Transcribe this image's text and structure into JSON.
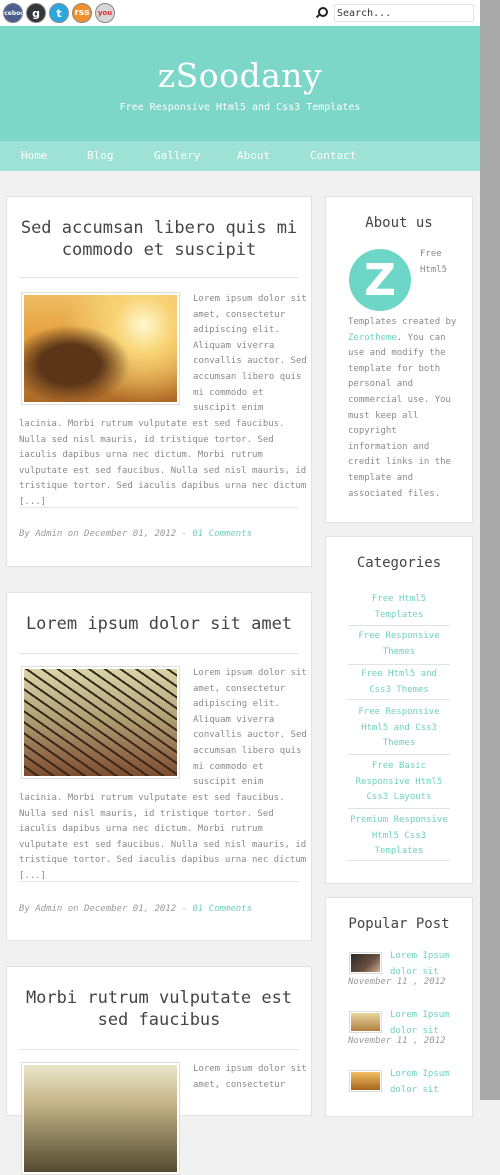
{
  "topbar": {
    "social": [
      "facebook",
      "g",
      "t",
      "rss",
      "you"
    ],
    "search_placeholder": "Search..."
  },
  "header": {
    "site_title": "zSoodany",
    "tagline": "Free Responsive Html5 and Css3 Templates"
  },
  "nav": {
    "items": [
      {
        "label": "Home"
      },
      {
        "label": "Blog"
      },
      {
        "label": "Gallery"
      },
      {
        "label": "About"
      },
      {
        "label": "Contact"
      }
    ]
  },
  "posts": [
    {
      "title": "Sed accumsan libero quis mi commodo et suscipit",
      "image": "girl-in-field",
      "excerpt_right": "Lorem ipsum dolor sit amet, consectetur adipiscing elit. Aliquam viverra convallis auctor. Sed accumsan libero quis mi commodo et suscipit enim",
      "excerpt_full": "lacinia. Morbi rutrum vulputate est sed faucibus. Nulla sed nisl mauris, id tristique tortor. Sed iaculis dapibus urna nec dictum. Morbi rutrum vulputate est sed faucibus. Nulla sed nisl mauris, id tristique tortor. Sed iaculis dapibus urna nec dictum [...]",
      "meta": "By Admin on December 01, 2012 - ",
      "comments": "01 Comments"
    },
    {
      "title": "Lorem ipsum dolor sit amet",
      "image": "bridge",
      "excerpt_right": "Lorem ipsum dolor sit amet, consectetur adipiscing elit. Aliquam viverra convallis auctor. Sed accumsan libero quis mi commodo et suscipit enim",
      "excerpt_full": "lacinia. Morbi rutrum vulputate est sed faucibus. Nulla sed nisl mauris, id tristique tortor. Sed iaculis dapibus urna nec dictum. Morbi rutrum vulputate est sed faucibus. Nulla sed nisl mauris, id tristique tortor. Sed iaculis dapibus urna nec dictum [...]",
      "meta": "By Admin on December 01, 2012 - ",
      "comments": "01 Comments"
    },
    {
      "title": "Morbi rutrum vulputate est sed faucibus",
      "image": "field",
      "excerpt_right": "Lorem ipsum dolor sit amet, consectetur"
    }
  ],
  "sidebar": {
    "about": {
      "title": "About us",
      "logo_letter": "Z",
      "side_text": "Free Html5",
      "text_before": "Templates created by ",
      "link": "Zerotheme",
      "text_after": ". You can use and modify the template for both personal and commercial use. You must keep all copyright information and credit links in the template and associated files."
    },
    "categories": {
      "title": "Categories",
      "items": [
        "Free Html5 Templates",
        "Free Responsive Themes",
        "Free Html5 and Css3 Themes",
        "Free Responsive Html5 and Css3 Themes",
        "Free Basic Responsive Html5 Css3 Layouts",
        "Premium Responsive Html5 Css3 Templates"
      ]
    },
    "popular": {
      "title": "Popular Post",
      "items": [
        {
          "title": "Lorem Ipsum dolor sit",
          "date": "November 11 , 2012"
        },
        {
          "title": "Lorem Ipsum dolor sit",
          "date": "November 11 , 2012"
        },
        {
          "title": "Lorem Ipsum dolor sit",
          "date": ""
        }
      ]
    }
  },
  "colors": {
    "accent": "#7dd7c8",
    "nav_bg": "#9ee2d6",
    "link": "#6fd1c1",
    "page_bg": "#f1f1f1"
  }
}
